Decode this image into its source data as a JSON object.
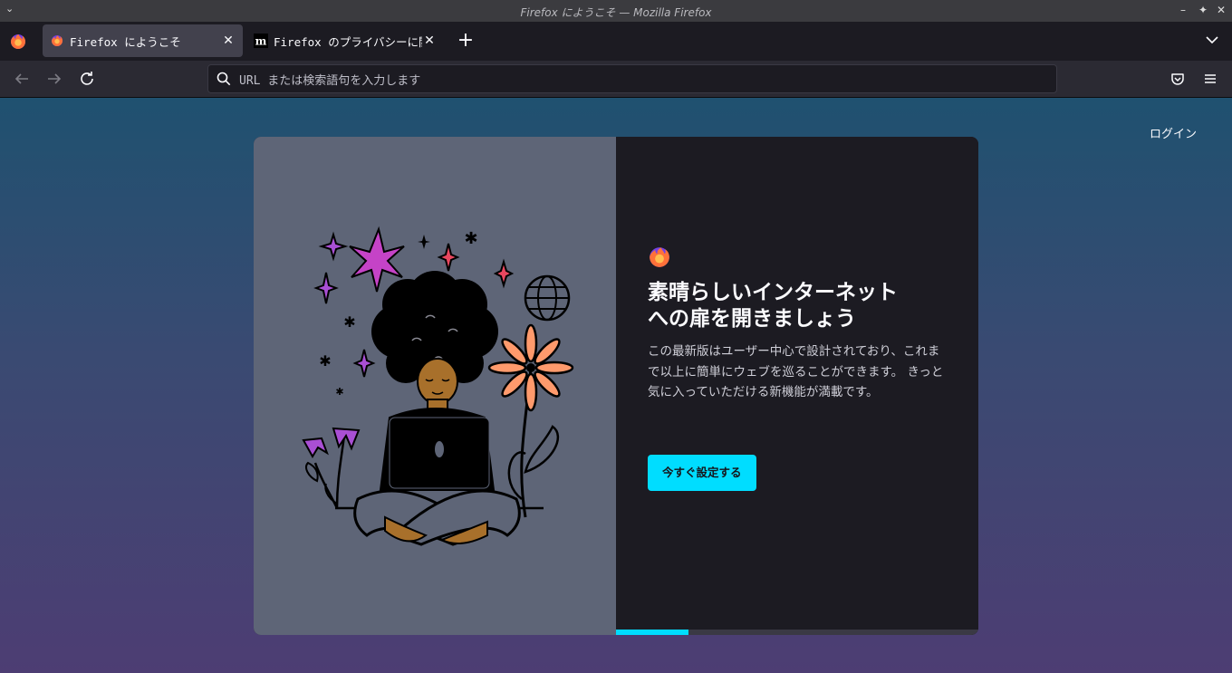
{
  "window": {
    "title": "Firefox にようこそ — Mozilla Firefox"
  },
  "tabs": [
    {
      "label": "Firefox にようこそ",
      "active": true,
      "favicon": "firefox-icon"
    },
    {
      "label": "Firefox のプライバシーに関",
      "active": false,
      "favicon": "mozilla-m-icon"
    }
  ],
  "navbar": {
    "url_placeholder": "URL または検索語句を入力します",
    "icons": [
      "back-icon",
      "forward-icon",
      "reload-icon",
      "pocket-icon",
      "menu-icon"
    ]
  },
  "content": {
    "login_label": "ログイン",
    "headline_line1": "素晴らしいインターネット",
    "headline_line2": "への扉を開きましょう",
    "subtext": "この最新版はユーザー中心で設計されており、これまで以上に簡単にウェブを巡ることができます。 きっと気に入っていただける新機能が満載です。",
    "cta_label": "今すぐ設定する",
    "progress_fraction": 0.2
  },
  "colors": {
    "accent": "#00ddff",
    "card_left_bg": "#5e6577",
    "card_right_bg": "#1c1b22"
  }
}
